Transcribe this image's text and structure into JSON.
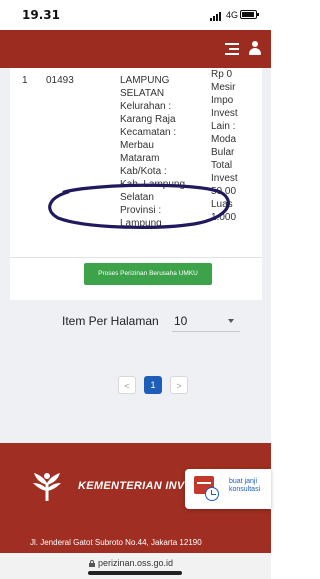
{
  "status_bar": {
    "time": "19.31",
    "network": "4G"
  },
  "table": {
    "row": {
      "number": "1",
      "id": "01493",
      "location_lines": [
        "LAMPUNG",
        "SELATAN",
        "Kelurahan :",
        "Karang Raja",
        "Kecamatan :",
        "Merbau",
        "Mataram",
        "Kab/Kota :",
        "Kab. Lampung",
        "Selatan",
        "Provinsi :",
        "Lampung"
      ],
      "investment_lines": [
        "Rp 0",
        "Mesir",
        "Impo",
        "Invest",
        "Lain :",
        "Moda",
        "Bular",
        "Total",
        "Invest",
        "50.00",
        "Luas",
        "1.000"
      ]
    },
    "action_label": "Proses Perizinan Berusaha UMKU"
  },
  "pagination": {
    "per_page_label": "Item Per Halaman",
    "per_page_value": "10",
    "prev": "<",
    "current": "1",
    "next": ">"
  },
  "footer": {
    "title": "KEMENTERIAN INV",
    "address": "Jl. Jenderal Gatot Subroto No.44, Jakarta 12190"
  },
  "consult": {
    "label": "buat janji konsultasi"
  },
  "browser": {
    "url": "perizinan.oss.go.id"
  },
  "colors": {
    "header": "#9b2c1f",
    "footer": "#a02e22",
    "action": "#3da34a",
    "accent": "#1d5fb8"
  },
  "icons": [
    "signal-icon",
    "battery-icon",
    "hamburger-icon",
    "user-icon",
    "calendar-icon",
    "clock-icon",
    "lock-icon",
    "chevron-down-icon"
  ]
}
